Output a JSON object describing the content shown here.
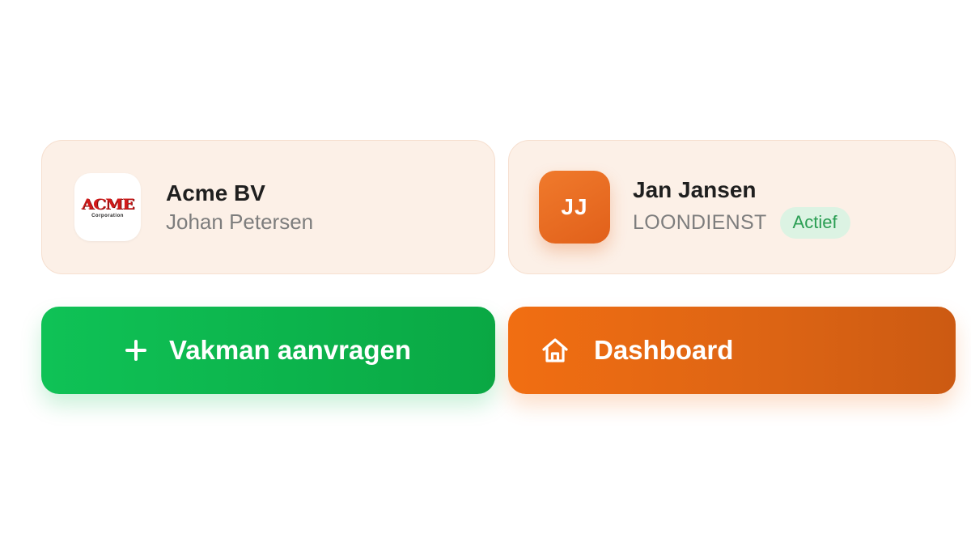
{
  "company_card": {
    "logo_text": "ACME",
    "logo_subtext": "Corporation",
    "name": "Acme BV",
    "contact": "Johan Petersen"
  },
  "user_card": {
    "initials": "JJ",
    "name": "Jan Jansen",
    "role": "LOONDIENST",
    "status": "Actief",
    "status_color": "#2a9e53"
  },
  "actions": {
    "request_label": "Vakman aanvragen",
    "request_icon": "plus-icon",
    "dashboard_label": "Dashboard",
    "dashboard_icon": "home-icon"
  },
  "colors": {
    "green": "#0fc256",
    "orange": "#f16e12",
    "card_bg": "#fcf0e7"
  }
}
